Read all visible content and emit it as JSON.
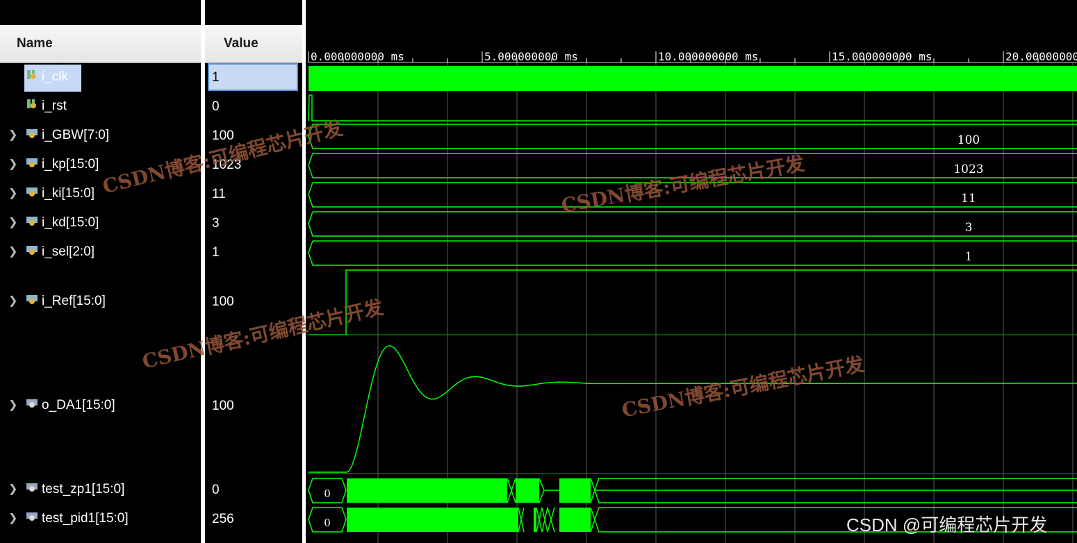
{
  "columns": {
    "name": "Name",
    "value": "Value"
  },
  "signals": [
    {
      "name": "i_clk",
      "value": "1",
      "type": "bit"
    },
    {
      "name": "i_rst",
      "value": "0",
      "type": "bit"
    },
    {
      "name": "i_GBW[7:0]",
      "value": "100",
      "type": "bus"
    },
    {
      "name": "i_kp[15:0]",
      "value": "1023",
      "type": "bus"
    },
    {
      "name": "i_ki[15:0]",
      "value": "11",
      "type": "bus"
    },
    {
      "name": "i_kd[15:0]",
      "value": "3",
      "type": "bus"
    },
    {
      "name": "i_sel[2:0]",
      "value": "1",
      "type": "bus"
    },
    {
      "name": "i_Ref[15:0]",
      "value": "100",
      "type": "bus"
    },
    {
      "name": "o_DA1[15:0]",
      "value": "100",
      "type": "bus"
    },
    {
      "name": "test_zp1[15:0]",
      "value": "0",
      "type": "bus"
    },
    {
      "name": "test_pid1[15:0]",
      "value": "256",
      "type": "bus"
    }
  ],
  "timeline": {
    "ticks": [
      "0.000000000 ms",
      "5.000000000 ms",
      "10.000000000 ms",
      "15.000000000 ms",
      "20.00000000"
    ]
  },
  "wave_labels": {
    "gbw": "100",
    "kp": "1023",
    "ki": "11",
    "kd": "3",
    "sel": "1",
    "zp1_start": "0",
    "pid1_start": "0"
  },
  "watermarks": {
    "text": "CSDN博客:可编程芯片开发",
    "corner": "CSDN @可编程芯片开发"
  },
  "colors": {
    "wave": "#00ff00",
    "grid": "#5a5a5a",
    "selection": "#c9daf5",
    "watermark": "#965537"
  },
  "icons": {
    "bit_signal": "signal-bit-icon",
    "bus_signal": "signal-bus-icon",
    "output_signal": "signal-output-icon",
    "expand": "chevron-right-icon"
  }
}
